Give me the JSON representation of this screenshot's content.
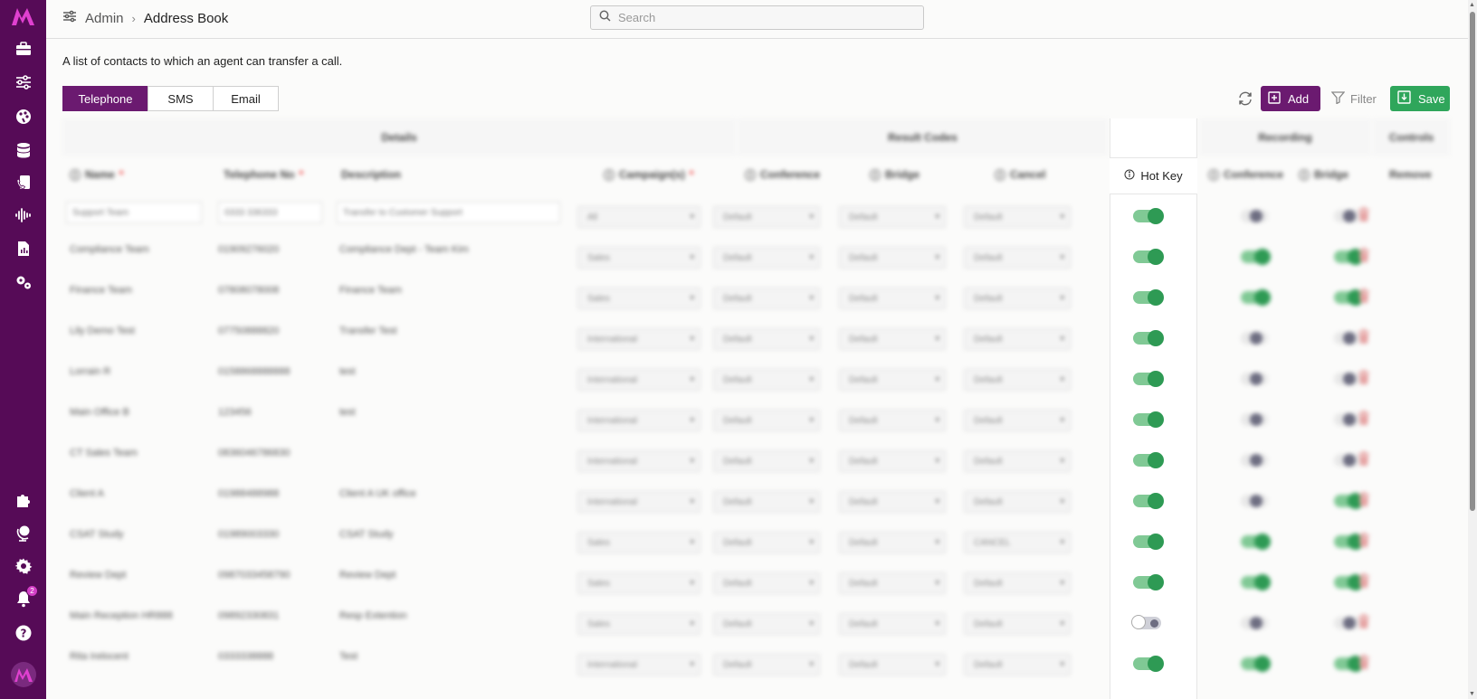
{
  "nav": {
    "logo": "M",
    "icons_top": [
      "briefcase-icon",
      "sliders-icon",
      "palette-icon",
      "database-icon",
      "phone-book-icon",
      "waveform-icon",
      "report-icon",
      "gears-icon"
    ],
    "icons_bottom": [
      "puzzle-icon",
      "globe-icon",
      "settings-icon",
      "bell-icon",
      "help-icon"
    ],
    "notification_count": "2",
    "brand_color": "#560b57"
  },
  "header": {
    "breadcrumb_parent": "Admin",
    "breadcrumb_separator": "›",
    "breadcrumb_current": "Address Book",
    "search_placeholder": "Search"
  },
  "page": {
    "description": "A list of contacts to which an agent can transfer a call."
  },
  "tabs": [
    {
      "label": "Telephone",
      "active": true
    },
    {
      "label": "SMS",
      "active": false
    },
    {
      "label": "Email",
      "active": false
    }
  ],
  "toolbar": {
    "add_label": "Add",
    "filter_label": "Filter",
    "save_label": "Save",
    "add_color": "#6b1a70",
    "save_color": "#2fa65b"
  },
  "table": {
    "groups": {
      "details": "Details",
      "result_codes": "Result Codes",
      "recording": "Recording",
      "controls": "Controls"
    },
    "columns": {
      "name": "Name",
      "telephone": "Telephone No",
      "description": "Description",
      "campaign": "Campaign(s)",
      "conference": "Conference",
      "bridge": "Bridge",
      "cancel": "Cancel",
      "hot_key": "Hot Key",
      "rec_conference": "Conference",
      "rec_bridge": "Bridge",
      "remove": "Remove"
    },
    "rows": [
      {
        "name": "Support Team",
        "tel": "0333 336333",
        "desc": "Transfer to Customer Support",
        "campaign": "All",
        "conf": "Default",
        "bridge": "Default",
        "cancel": "Default",
        "hotkey": true,
        "rec_conf": false,
        "rec_bridge": false,
        "editing": true
      },
      {
        "name": "Compliance Team",
        "tel": "01909276020",
        "desc": "Compliance Dept - Team Kim",
        "campaign": "Sales",
        "conf": "Default",
        "bridge": "Default",
        "cancel": "Default",
        "hotkey": true,
        "rec_conf": true,
        "rec_bridge": true
      },
      {
        "name": "Finance Team",
        "tel": "07808078008",
        "desc": "Finance Team",
        "campaign": "Sales",
        "conf": "Default",
        "bridge": "Default",
        "cancel": "Default",
        "hotkey": true,
        "rec_conf": true,
        "rec_bridge": true
      },
      {
        "name": "Lily Demo Test",
        "tel": "07750888820",
        "desc": "Transfer Test",
        "campaign": "International",
        "conf": "Default",
        "bridge": "Default",
        "cancel": "Default",
        "hotkey": true,
        "rec_conf": false,
        "rec_bridge": false
      },
      {
        "name": "Lorrain R",
        "tel": "0158868888888",
        "desc": "test",
        "campaign": "International",
        "conf": "Default",
        "bridge": "Default",
        "cancel": "Default",
        "hotkey": true,
        "rec_conf": false,
        "rec_bridge": false
      },
      {
        "name": "Main Office B",
        "tel": "123456",
        "desc": "test",
        "campaign": "International",
        "conf": "Default",
        "bridge": "Default",
        "cancel": "Default",
        "hotkey": true,
        "rec_conf": false,
        "rec_bridge": false
      },
      {
        "name": "CT Sales Team",
        "tel": "0836046786830",
        "desc": "",
        "campaign": "International",
        "conf": "Default",
        "bridge": "Default",
        "cancel": "Default",
        "hotkey": true,
        "rec_conf": false,
        "rec_bridge": false
      },
      {
        "name": "Client A",
        "tel": "01988488988",
        "desc": "Client A UK office",
        "campaign": "International",
        "conf": "Default",
        "bridge": "Default",
        "cancel": "Default",
        "hotkey": true,
        "rec_conf": false,
        "rec_bridge": true
      },
      {
        "name": "CSAT Study",
        "tel": "01989003330",
        "desc": "CSAT Study",
        "campaign": "Sales",
        "conf": "Default",
        "bridge": "Default",
        "cancel": "CANCEL",
        "hotkey": true,
        "rec_conf": true,
        "rec_bridge": true
      },
      {
        "name": "Review Dept",
        "tel": "0987033458790",
        "desc": "Review Dept",
        "campaign": "Sales",
        "conf": "Default",
        "bridge": "Default",
        "cancel": "Default",
        "hotkey": true,
        "rec_conf": true,
        "rec_bridge": true
      },
      {
        "name": "Main Reception HR888",
        "tel": "09892330831",
        "desc": "Resp Extention",
        "campaign": "Sales",
        "conf": "Default",
        "bridge": "Default",
        "cancel": "Default",
        "hotkey": false,
        "rec_conf": false,
        "rec_bridge": false
      },
      {
        "name": "Rita Irelocent",
        "tel": "0333338888",
        "desc": "Test",
        "campaign": "International",
        "conf": "Default",
        "bridge": "Default",
        "cancel": "Default",
        "hotkey": true,
        "rec_conf": true,
        "rec_bridge": true
      }
    ]
  }
}
